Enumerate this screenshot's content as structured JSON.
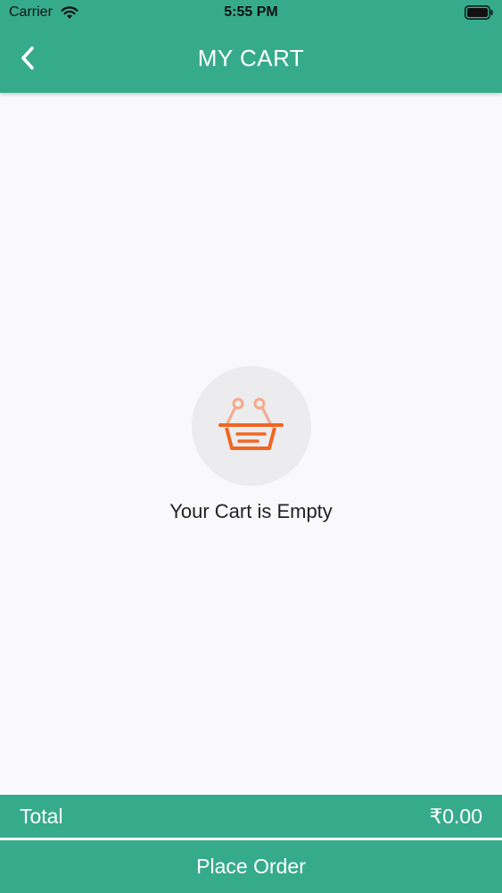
{
  "status_bar": {
    "carrier": "Carrier",
    "time": "5:55 PM",
    "icons": [
      "wifi-icon",
      "battery-icon"
    ]
  },
  "header": {
    "title": "MY CART",
    "back_icon": "chevron-left-icon"
  },
  "empty_state": {
    "icon": "basket-icon",
    "message": "Your Cart is Empty"
  },
  "footer": {
    "total_label": "Total",
    "total_value": "₹0.00",
    "place_order_label": "Place Order"
  },
  "colors": {
    "primary": "#36ab8c",
    "basket_orange": "#f26522",
    "basket_light": "#f5a98a",
    "background": "#f9f9fb"
  }
}
